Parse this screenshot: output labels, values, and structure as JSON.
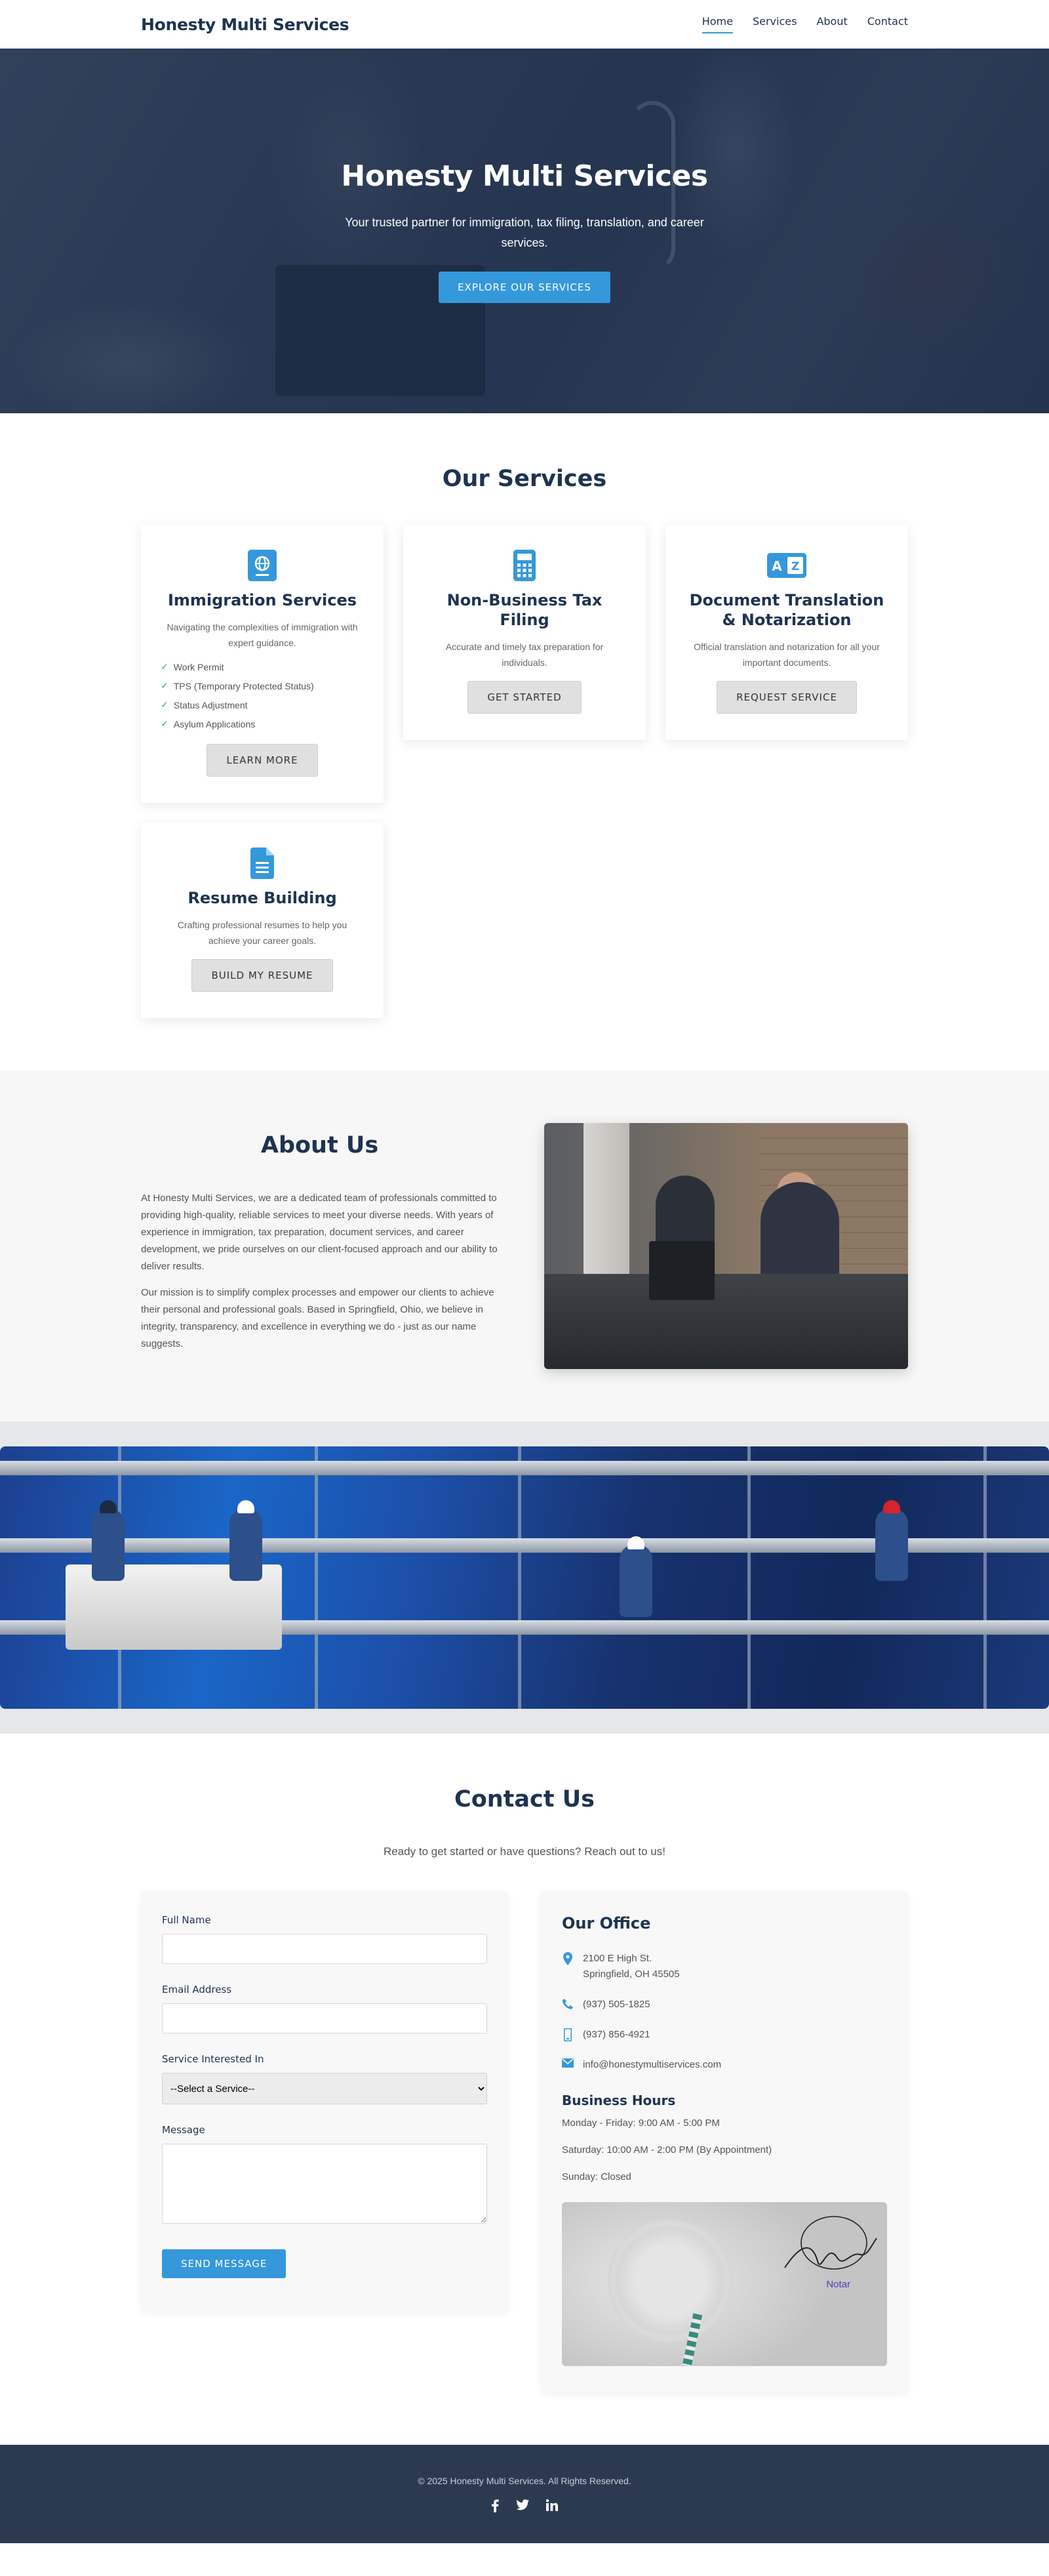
{
  "header": {
    "brand": "Honesty Multi Services",
    "nav": [
      "Home",
      "Services",
      "About",
      "Contact"
    ],
    "active_nav": "Home"
  },
  "hero": {
    "title": "Honesty Multi Services",
    "subtitle": "Your trusted partner for immigration, tax filing, translation, and career services.",
    "cta": "EXPLORE OUR SERVICES"
  },
  "services": {
    "title": "Our Services",
    "cards": [
      {
        "icon": "passport-icon",
        "title": "Immigration Services",
        "description": "Navigating the complexities of immigration with expert guidance.",
        "features": [
          "Work Permit",
          "TPS (Temporary Protected Status)",
          "Status Adjustment",
          "Asylum Applications"
        ],
        "button": "LEARN MORE"
      },
      {
        "icon": "calculator-icon",
        "title": "Non-Business Tax Filing",
        "description": "Accurate and timely tax preparation for individuals.",
        "button": "GET STARTED"
      },
      {
        "icon": "language-icon",
        "title": "Document Translation & Notarization",
        "description": "Official translation and notarization for all your important documents.",
        "button": "REQUEST SERVICE"
      },
      {
        "icon": "file-icon",
        "title": "Resume Building",
        "description": "Crafting professional resumes to help you achieve your career goals.",
        "button": "BUILD MY RESUME"
      }
    ]
  },
  "about": {
    "title": "About Us",
    "paragraphs": [
      "At Honesty Multi Services, we are a dedicated team of professionals committed to providing high-quality, reliable services to meet your diverse needs. With years of experience in immigration, tax preparation, document services, and career development, we pride ourselves on our client-focused approach and our ability to deliver results.",
      "Our mission is to simplify complex processes and empower our clients to achieve their personal and professional goals. Based in Springfield, Ohio, we believe in integrity, transparency, and excellence in everything we do - just as our name suggests."
    ]
  },
  "contact": {
    "title": "Contact Us",
    "subtitle": "Ready to get started or have questions? Reach out to us!",
    "form": {
      "name_label": "Full Name",
      "email_label": "Email Address",
      "service_label": "Service Interested In",
      "service_selected": "--Select a Service--",
      "message_label": "Message",
      "submit": "SEND MESSAGE"
    },
    "office": {
      "title": "Our Office",
      "address_line1": "2100 E High St.",
      "address_line2": "Springfield, OH 45505",
      "phone": "(937) 505-1825",
      "mobile": "(937) 856-4921",
      "email": "info@honestymultiservices.com",
      "hours_title": "Business Hours",
      "hours": [
        "Monday - Friday: 9:00 AM - 5:00 PM",
        "Saturday: 10:00 AM - 2:00 PM (By Appointment)",
        "Sunday: Closed"
      ],
      "stamp_text": "Notar"
    }
  },
  "footer": {
    "copyright": "© 2025 Honesty Multi Services. All Rights Reserved.",
    "socials": [
      "facebook-icon",
      "twitter-icon",
      "linkedin-icon"
    ]
  },
  "colors": {
    "accent": "#3498db",
    "navy": "#1e3350",
    "footer": "#2c3a4f",
    "check": "#3ab07a"
  }
}
